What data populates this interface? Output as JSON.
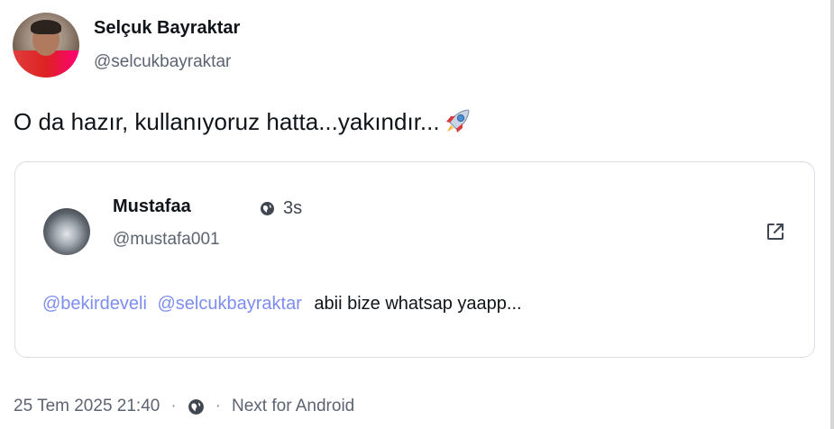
{
  "post": {
    "author_name": "Selçuk Bayraktar",
    "author_handle": "@selcukbayraktar",
    "text": "O da hazır, kullanıyoruz hatta...yakındır...",
    "text_icon": "rocket-emoji"
  },
  "quoted_post": {
    "author_name": "Mustafaa",
    "time": "3s",
    "time_icon": "globe-icon",
    "author_handle": "@mustafa001",
    "mentions": [
      "@bekirdeveli",
      "@selcukbayraktar"
    ],
    "text": "abii bize whatsap yaapp...",
    "action_icon": "open-external-icon"
  },
  "footer": {
    "timestamp": "25 Tem 2025 21:40",
    "separator": "·",
    "visibility_icon": "globe-icon",
    "client": "Next for Android"
  },
  "colors": {
    "mention": "#7d8df0",
    "text": "#0f1419",
    "muted": "#5b6470",
    "border": "#d9dee5"
  }
}
